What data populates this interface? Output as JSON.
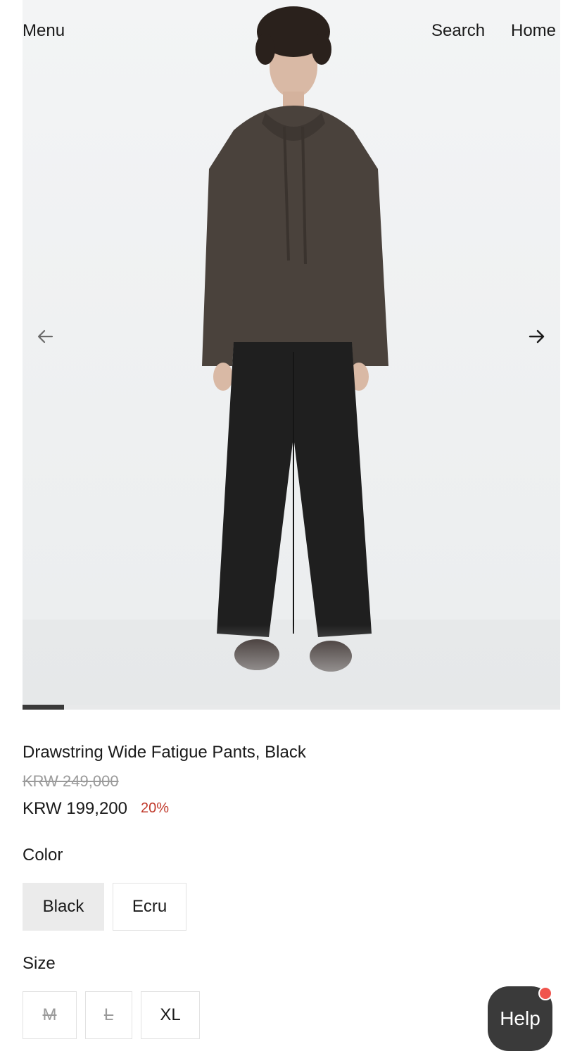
{
  "nav": {
    "menu_label": "Menu",
    "search_label": "Search",
    "home_label": "Home"
  },
  "gallery": {
    "prev_icon": "arrow-left-icon",
    "next_icon": "arrow-right-icon",
    "image_alt": "Model wearing brown knit hoodie and black drawstring wide fatigue pants",
    "progress_fraction": 0.077,
    "colors": {
      "sweater": "#4a423c",
      "pants": "#1f1f1f",
      "shoes": "#2e2320"
    }
  },
  "product": {
    "title": "Drawstring Wide Fatigue Pants, Black",
    "original_price": "KRW 249,000",
    "price": "KRW 199,200",
    "discount": "20%",
    "discount_color": "#c0392b"
  },
  "color_section": {
    "label": "Color",
    "options": [
      {
        "label": "Black",
        "selected": true
      },
      {
        "label": "Ecru",
        "selected": false
      }
    ]
  },
  "size_section": {
    "label": "Size",
    "options": [
      {
        "label": "M",
        "available": false
      },
      {
        "label": "L",
        "available": false
      },
      {
        "label": "XL",
        "available": true
      }
    ]
  },
  "help": {
    "label": "Help",
    "badge_color": "#f0554d"
  }
}
